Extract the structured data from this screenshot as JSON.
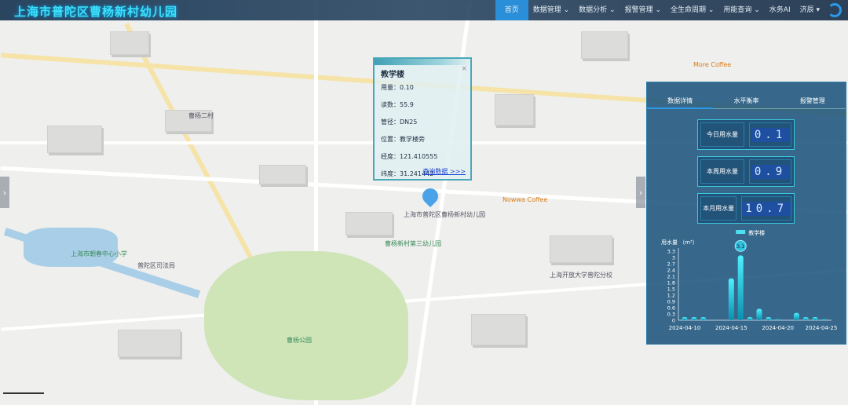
{
  "header": {
    "title": "上海市普陀区曹杨新村幼儿园",
    "nav": [
      "首页",
      "数据管理 ⌄",
      "数据分析 ⌄",
      "报警管理 ⌄",
      "全生命周期 ⌄",
      "用能查询 ⌄",
      "水务AI",
      "济辰 ▾"
    ]
  },
  "popup": {
    "title": "教学楼",
    "rows": [
      "用量：0.10",
      "读数：55.9",
      "管径：DN25",
      "位置：教学楼旁",
      "经度：121.410555",
      "纬度：31.241442"
    ],
    "link": "查询数据 >>>",
    "close": "×"
  },
  "map": {
    "marker_label": "上海市普陀区曹杨新村幼儿园",
    "labels": [
      "曹杨新村第三幼儿园",
      "曹杨公园",
      "上海市朝春中心小学",
      "普陀区司法局",
      "上海开放大学普陀分校",
      "Nowwa Coffee",
      "More Coffee",
      "曹杨二村"
    ]
  },
  "panel": {
    "tabs": [
      "数据详情",
      "水平衡率",
      "报警管理"
    ],
    "stats": [
      {
        "label": "今日用水量",
        "value": "0.1"
      },
      {
        "label": "本周用水量",
        "value": "0.9"
      },
      {
        "label": "本月用水量",
        "value": "10.7"
      }
    ]
  },
  "chart_data": {
    "type": "bar",
    "ylabel": "用水量 （m³）",
    "series_name": "教学楼",
    "highlight": "3.1",
    "x": [
      "04-10",
      "04-11",
      "04-12",
      "04-13",
      "04-14",
      "04-15",
      "04-16",
      "04-17",
      "04-18",
      "04-19",
      "04-20",
      "04-21",
      "04-22",
      "04-23",
      "04-24",
      "04-25"
    ],
    "values": [
      0.15,
      0.15,
      0.15,
      0,
      0,
      2.0,
      3.1,
      0.15,
      0.55,
      0.15,
      0.05,
      0,
      0.35,
      0.15,
      0.15,
      0.05
    ],
    "ylim": [
      0,
      3.3
    ],
    "yticks": [
      "0",
      "0.3",
      "0.6",
      "0.9",
      "1.2",
      "1.5",
      "1.8",
      "2.1",
      "2.4",
      "2.7",
      "3",
      "3.3"
    ],
    "xticks": [
      "2024-04-10",
      "2024-04-15",
      "2024-04-20",
      "2024-04-25"
    ]
  }
}
